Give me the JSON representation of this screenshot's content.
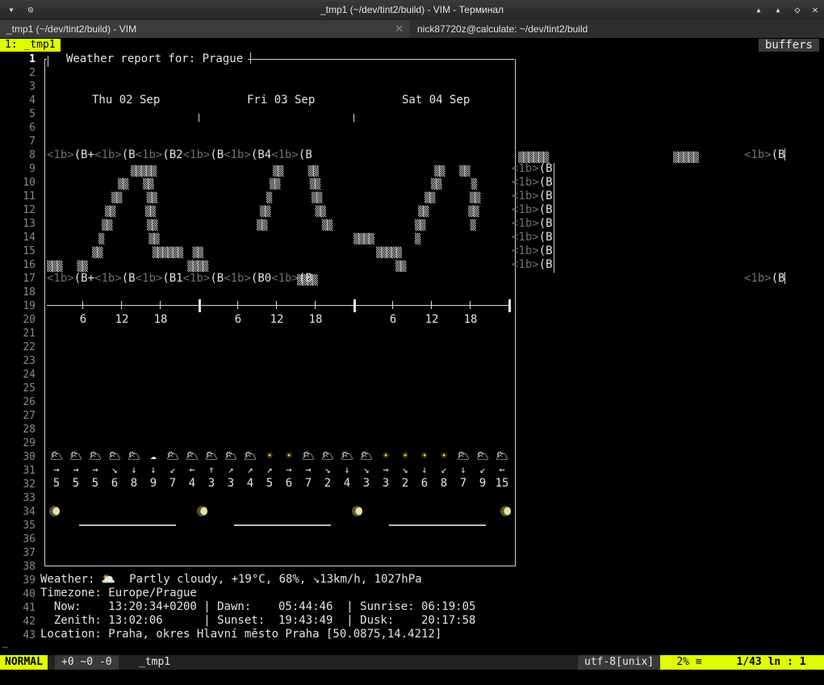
{
  "window": {
    "title": "_tmp1 (~/dev/tint2/build) - VIM - Терминал"
  },
  "tabs": [
    {
      "label": "_tmp1 (~/dev/tint2/build) - VIM"
    },
    {
      "label": "nick87720z@calculate: ~/dev/tint2/build"
    }
  ],
  "bufferline": {
    "current": "1: _tmp1",
    "right": "buffers"
  },
  "report": {
    "title": "Weather report for: Prague",
    "days": [
      "Thu 02 Sep",
      "Fri 03 Sep",
      "Sat 04 Sep"
    ],
    "hours": [
      "6",
      "12",
      "18"
    ],
    "line8": "<1b>(B+<1b>(B<1b>(B2<1b>(B<1b>(B4<1b>(B",
    "line17": "<1b>(B+<1b>(B<1b>(B1<1b>(B<1b>(B0<1b>(B",
    "wind_arrows": [
      "→",
      "→",
      "→",
      "↘",
      "↓",
      "↓",
      "↙",
      "←",
      "↑",
      "↗",
      "↗",
      "↗",
      "→",
      "→",
      "↘",
      "↓",
      "↘",
      "→",
      "↘",
      "↓",
      "↙",
      "↓",
      "↙",
      "←"
    ],
    "wind_speeds": [
      "5",
      "5",
      "5",
      "6",
      "8",
      "9",
      "7",
      "4",
      "3",
      "3",
      "4",
      "5",
      "6",
      "7",
      "2",
      "4",
      "3",
      "3",
      "2",
      "6",
      "8",
      "7",
      "9",
      "15"
    ],
    "weather_icons": [
      "cloud-sun",
      "cloud-sun",
      "cloud-sun",
      "cloud-sun",
      "cloud-sun",
      "cloud",
      "cloud-sun",
      "cloud-sun",
      "cloud-sun",
      "cloud-sun",
      "cloud-sun",
      "sun",
      "sun",
      "cloud-sun",
      "cloud-sun",
      "cloud-sun",
      "cloud-sun",
      "sun",
      "sun",
      "sun",
      "sun",
      "cloud-sun",
      "cloud-sun",
      "cloud-sun"
    ]
  },
  "info": {
    "weather": "Weather: 🌥️  Partly cloudy, +19°C, 68%, ↘13km/h, 1027hPa",
    "timezone": "Timezone: Europe/Prague",
    "now_line": "  Now:    13:20:34+0200 | Dawn:    05:44:46  | Sunrise: 06:19:05",
    "zenith_line": "  Zenith: 13:02:06      | Sunset:  19:43:49  | Dusk:    20:17:58",
    "location": "Location: Praha, okres Hlavní město Praha [50.0875,14.4212]"
  },
  "statusline": {
    "mode": "NORMAL",
    "diff": "+0 ~0 -0",
    "file": "_tmp1",
    "encoding": "utf-8[unix]",
    "percent": "2% ≡",
    "position": "1/43 ln :  1"
  },
  "colors": {
    "accent": "#dfff00",
    "background": "#000000"
  }
}
